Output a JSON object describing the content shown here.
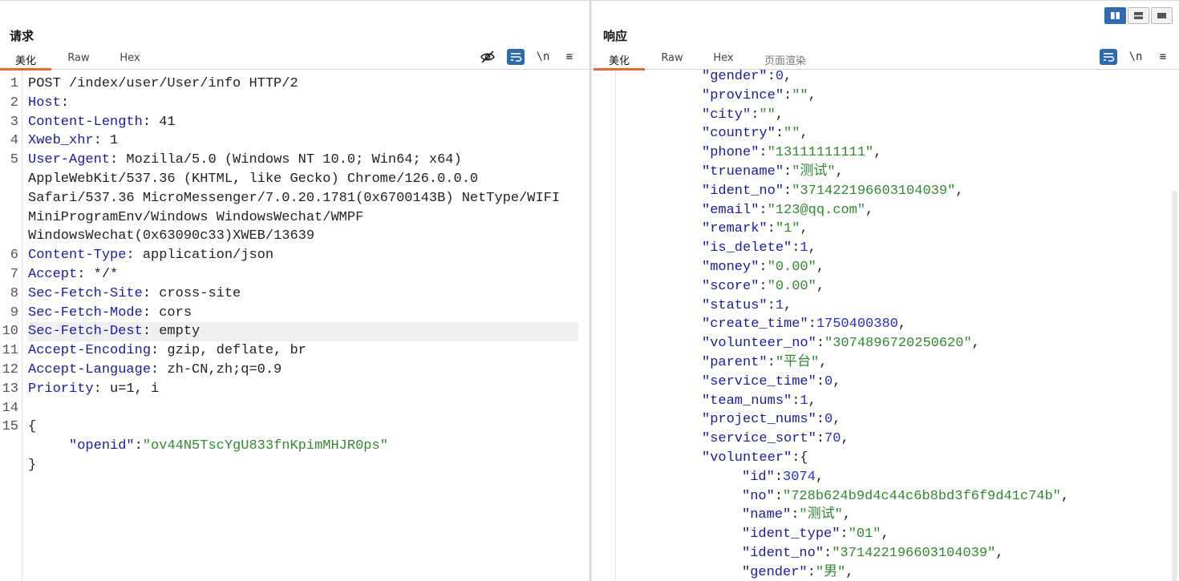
{
  "request": {
    "title": "请求",
    "tabs": [
      "美化",
      "Raw",
      "Hex"
    ],
    "lines": [
      {
        "num": "1",
        "parts": [
          {
            "t": "POST /index/user/User/info HTTP/2",
            "c": "v"
          }
        ]
      },
      {
        "num": "2",
        "parts": [
          {
            "t": "Host",
            "c": "k"
          },
          {
            "t": ":",
            "c": "p"
          }
        ]
      },
      {
        "num": "3",
        "parts": [
          {
            "t": "Content-Length",
            "c": "k"
          },
          {
            "t": ": 41",
            "c": "v"
          }
        ]
      },
      {
        "num": "4",
        "parts": [
          {
            "t": "Xweb_xhr",
            "c": "k"
          },
          {
            "t": ": 1",
            "c": "v"
          }
        ]
      },
      {
        "num": "5",
        "parts": [
          {
            "t": "User-Agent",
            "c": "k"
          },
          {
            "t": ": Mozilla/5.0 (Windows NT 10.0; Win64; x64)",
            "c": "v"
          }
        ]
      },
      {
        "num": "",
        "parts": [
          {
            "t": "AppleWebKit/537.36 (KHTML, like Gecko) Chrome/126.0.0.0",
            "c": "v"
          }
        ]
      },
      {
        "num": "",
        "parts": [
          {
            "t": "Safari/537.36 MicroMessenger/7.0.20.1781(0x6700143B) NetType/WIFI",
            "c": "v"
          }
        ]
      },
      {
        "num": "",
        "parts": [
          {
            "t": "MiniProgramEnv/Windows WindowsWechat/WMPF",
            "c": "v"
          }
        ]
      },
      {
        "num": "",
        "parts": [
          {
            "t": "WindowsWechat(0x63090c33)XWEB/13639",
            "c": "v"
          }
        ]
      },
      {
        "num": "6",
        "parts": [
          {
            "t": "Content-Type",
            "c": "k"
          },
          {
            "t": ": application/json",
            "c": "v"
          }
        ]
      },
      {
        "num": "7",
        "parts": [
          {
            "t": "Accept",
            "c": "k"
          },
          {
            "t": ": */*",
            "c": "v"
          }
        ]
      },
      {
        "num": "8",
        "parts": [
          {
            "t": "Sec-Fetch-Site",
            "c": "k"
          },
          {
            "t": ": cross-site",
            "c": "v"
          }
        ]
      },
      {
        "num": "9",
        "parts": [
          {
            "t": "Sec-Fetch-Mode",
            "c": "k"
          },
          {
            "t": ": cors",
            "c": "v"
          }
        ]
      },
      {
        "num": "10",
        "hl": true,
        "parts": [
          {
            "t": "Sec-Fetch-Dest",
            "c": "k"
          },
          {
            "t": ": empty",
            "c": "v"
          }
        ]
      },
      {
        "num": "11",
        "parts": [
          {
            "t": "Accept-Encoding",
            "c": "k"
          },
          {
            "t": ": gzip, deflate, br",
            "c": "v"
          }
        ]
      },
      {
        "num": "12",
        "parts": [
          {
            "t": "Accept-Language",
            "c": "k"
          },
          {
            "t": ": zh-CN,zh;q=0.9",
            "c": "v"
          }
        ]
      },
      {
        "num": "13",
        "parts": [
          {
            "t": "Priority",
            "c": "k"
          },
          {
            "t": ": u=1, i",
            "c": "v"
          }
        ]
      },
      {
        "num": "14",
        "parts": [
          {
            "t": "",
            "c": "v"
          }
        ]
      },
      {
        "num": "15",
        "parts": [
          {
            "t": "{",
            "c": "p"
          }
        ]
      },
      {
        "num": "",
        "parts": [
          {
            "t": "     ",
            "c": "p"
          },
          {
            "t": "\"openid\"",
            "c": "k"
          },
          {
            "t": ":",
            "c": "p"
          },
          {
            "t": "\"ov44N5TscYgU833fnKpimMHJR0ps\"",
            "c": "s"
          }
        ]
      },
      {
        "num": "",
        "parts": [
          {
            "t": "}",
            "c": "p"
          }
        ]
      }
    ]
  },
  "response": {
    "title": "响应",
    "tabs": [
      "美化",
      "Raw",
      "Hex",
      "页面渲染"
    ],
    "lines": [
      {
        "i": 0,
        "key": "\"gender\"",
        "val": "0",
        "vt": "n"
      },
      {
        "i": 0,
        "key": "\"province\"",
        "val": "\"\"",
        "vt": "s"
      },
      {
        "i": 0,
        "key": "\"city\"",
        "val": "\"\"",
        "vt": "s"
      },
      {
        "i": 0,
        "key": "\"country\"",
        "val": "\"\"",
        "vt": "s"
      },
      {
        "i": 0,
        "key": "\"phone\"",
        "val": "\"13111111111\"",
        "vt": "s"
      },
      {
        "i": 0,
        "key": "\"truename\"",
        "val": "\"测试\"",
        "vt": "s"
      },
      {
        "i": 0,
        "key": "\"ident_no\"",
        "val": "\"371422196603104039\"",
        "vt": "s"
      },
      {
        "i": 0,
        "key": "\"email\"",
        "val": "\"123@qq.com\"",
        "vt": "s"
      },
      {
        "i": 0,
        "key": "\"remark\"",
        "val": "\"1\"",
        "vt": "s"
      },
      {
        "i": 0,
        "key": "\"is_delete\"",
        "val": "1",
        "vt": "n"
      },
      {
        "i": 0,
        "key": "\"money\"",
        "val": "\"0.00\"",
        "vt": "s"
      },
      {
        "i": 0,
        "key": "\"score\"",
        "val": "\"0.00\"",
        "vt": "s"
      },
      {
        "i": 0,
        "key": "\"status\"",
        "val": "1",
        "vt": "n"
      },
      {
        "i": 0,
        "key": "\"create_time\"",
        "val": "1750400380",
        "vt": "n"
      },
      {
        "i": 0,
        "key": "\"volunteer_no\"",
        "val": "\"3074896720250620\"",
        "vt": "s"
      },
      {
        "i": 0,
        "key": "\"parent\"",
        "val": "\"平台\"",
        "vt": "s"
      },
      {
        "i": 0,
        "key": "\"service_time\"",
        "val": "0",
        "vt": "n"
      },
      {
        "i": 0,
        "key": "\"team_nums\"",
        "val": "1",
        "vt": "n"
      },
      {
        "i": 0,
        "key": "\"project_nums\"",
        "val": "0",
        "vt": "n"
      },
      {
        "i": 0,
        "key": "\"service_sort\"",
        "val": "70",
        "vt": "n"
      },
      {
        "i": 0,
        "key": "\"volunteer\"",
        "val": "{",
        "vt": "p",
        "noComma": true
      },
      {
        "i": 1,
        "key": "\"id\"",
        "val": "3074",
        "vt": "n"
      },
      {
        "i": 1,
        "key": "\"no\"",
        "val": "\"728b624b9d4c44c6b8bd3f6f9d41c74b\"",
        "vt": "s"
      },
      {
        "i": 1,
        "key": "\"name\"",
        "val": "\"测试\"",
        "vt": "s"
      },
      {
        "i": 1,
        "key": "\"ident_type\"",
        "val": "\"01\"",
        "vt": "s"
      },
      {
        "i": 1,
        "key": "\"ident_no\"",
        "val": "\"371422196603104039\"",
        "vt": "s"
      },
      {
        "i": 1,
        "key": "\"gender\"",
        "val": "\"男\"",
        "vt": "s"
      }
    ]
  },
  "icons": {
    "hide": "eye-off-icon",
    "wrap": "wrap-icon",
    "newline": "\\n",
    "menu": "≡"
  }
}
